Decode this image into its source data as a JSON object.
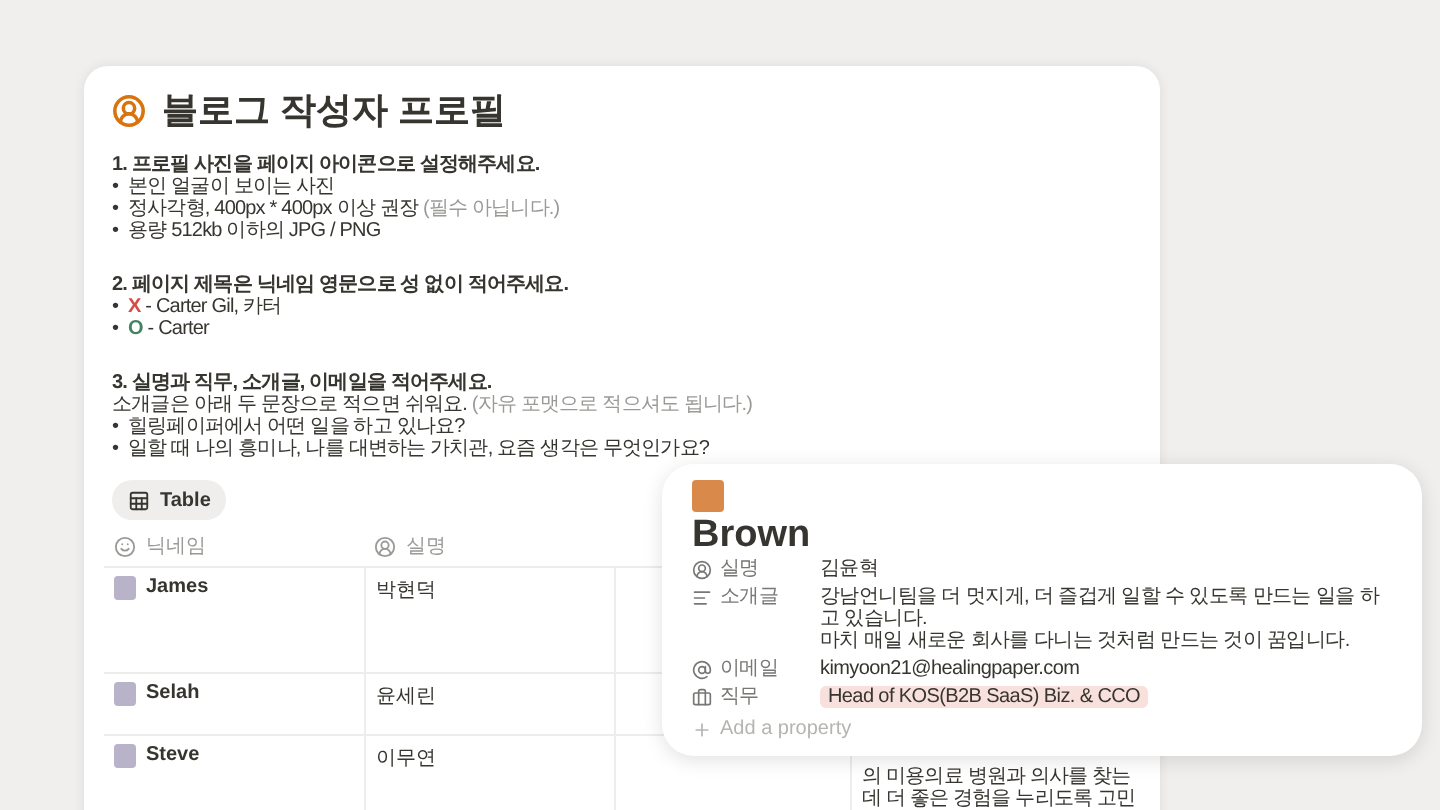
{
  "page": {
    "title": "블로그 작성자 프로필"
  },
  "instructions": [
    {
      "heading": "1. 프로필 사진을 페이지 아이콘으로 설정해주세요.",
      "lines": [
        {
          "kind": "bullet",
          "marker": "•",
          "text": "본인 얼굴이 보이는 사진"
        },
        {
          "kind": "bullet",
          "marker": "•",
          "text": "정사각형, 400px * 400px 이상 권장",
          "note": "(필수 아닙니다.)"
        },
        {
          "kind": "bullet",
          "marker": "•",
          "text": "용량 512kb 이하의 JPG / PNG"
        }
      ]
    },
    {
      "heading": "2. 페이지 제목은 닉네임 영문으로 성 없이 적어주세요.",
      "lines": [
        {
          "kind": "marked",
          "marker": "•",
          "mark": "X",
          "color": "#d44c47",
          "text": "- Carter Gil, 카터"
        },
        {
          "kind": "marked",
          "marker": "•",
          "mark": "O",
          "color": "#448361",
          "text": "- Carter"
        }
      ]
    },
    {
      "heading": "3. 실명과 직무, 소개글, 이메일을 적어주세요.",
      "lines": [
        {
          "kind": "plain",
          "text": "소개글은 아래 두 문장으로 적으면 쉬워요.",
          "note": "(자유 포맷으로 적으셔도 됩니다.)"
        },
        {
          "kind": "bullet",
          "marker": "•",
          "text": "힐링페이퍼에서 어떤 일을 하고 있나요?"
        },
        {
          "kind": "bullet",
          "marker": "•",
          "text": "일할 때 나의 흥미나, 나를 대변하는 가치관, 요즘 생각은 무엇인가요?"
        }
      ]
    }
  ],
  "view_tab": {
    "label": "Table",
    "selected": true
  },
  "table": {
    "columns": [
      "닉네임",
      "실명"
    ],
    "rows": [
      {
        "nickname": "James",
        "real_name": "박현덕"
      },
      {
        "nickname": "Selah",
        "real_name": "윤세린"
      },
      {
        "nickname": "Steve",
        "real_name": "이무연",
        "column_4": [
          "의 미용의료 병원과 의사를 찾는",
          "데 더 좋은 경험을 누리도록 고민"
        ]
      }
    ]
  },
  "profile_card": {
    "title": "Brown",
    "properties": [
      {
        "kind": "person",
        "label": "실명",
        "value": "김윤혁"
      },
      {
        "kind": "text",
        "label": "소개글",
        "value": "강남언니팀을 더 멋지게, 더 즐겁게 일할 수 있도록 만드는 일을 하고 있습니다.",
        "value_2": "마치 매일 새로운 회사를 다니는 것처럼 만드는 것이 꿈입니다."
      },
      {
        "kind": "email",
        "label": "이메일",
        "value": "kimyoon21@healingpaper.com"
      },
      {
        "kind": "select",
        "label": "직무",
        "value": "Head of KOS(B2B SaaS) Biz. & CCO"
      }
    ],
    "add_property": "Add a property"
  }
}
